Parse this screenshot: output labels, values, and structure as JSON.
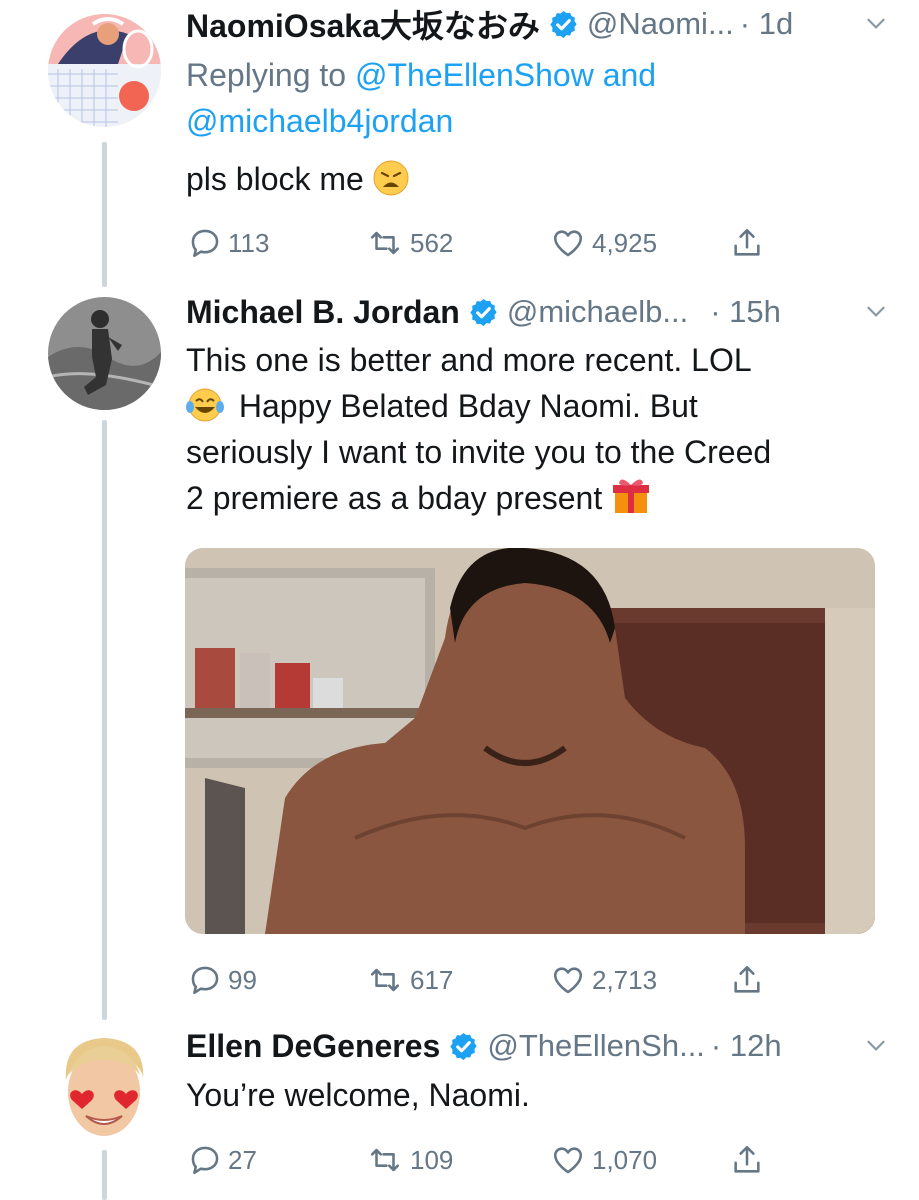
{
  "tweets": [
    {
      "name": "NaomiOsaka大坂なおみ",
      "handle": "@Naomi...",
      "time": "· 1d",
      "replying_prefix": "Replying to",
      "replying_to_1": "@TheEllenShow",
      "replying_and": "and",
      "replying_to_2": "@michaelb4jordan",
      "text": "pls block me",
      "replies": "113",
      "retweets": "562",
      "likes": "4,925"
    },
    {
      "name": "Michael B. Jordan",
      "handle": "@michaelb...",
      "time": "· 15h",
      "text_line1": "This one is better and more recent. LOL",
      "text_line2": "Happy Belated Bday Naomi. But",
      "text_line3": "seriously I want to invite you to the Creed",
      "text_line4": "2 premiere as a bday present",
      "replies": "99",
      "retweets": "617",
      "likes": "2,713"
    },
    {
      "name": "Ellen DeGeneres",
      "handle": "@TheEllenSh...",
      "time": "· 12h",
      "text": "You’re welcome, Naomi.",
      "replies": "27",
      "retweets": "109",
      "likes": "1,070"
    }
  ],
  "colors": {
    "link": "#1da1f2",
    "secondary": "#657786",
    "thread": "#ccd6dd",
    "text": "#14171a"
  },
  "icons": [
    "verified-badge-icon",
    "chevron-down-icon",
    "reply-icon",
    "retweet-icon",
    "like-icon",
    "share-icon"
  ]
}
